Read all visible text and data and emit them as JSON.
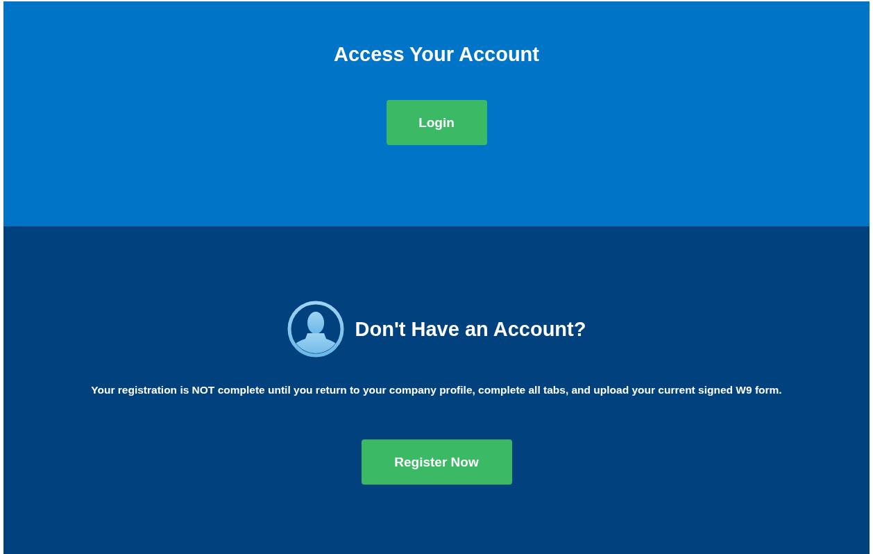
{
  "login_section": {
    "title": "Access Your Account",
    "button": "Login"
  },
  "register_section": {
    "title": "Don't Have an Account?",
    "message": "Your registration is NOT complete until you return to your company profile, complete all tabs, and upload your current signed W9 form.",
    "button": "Register Now"
  }
}
